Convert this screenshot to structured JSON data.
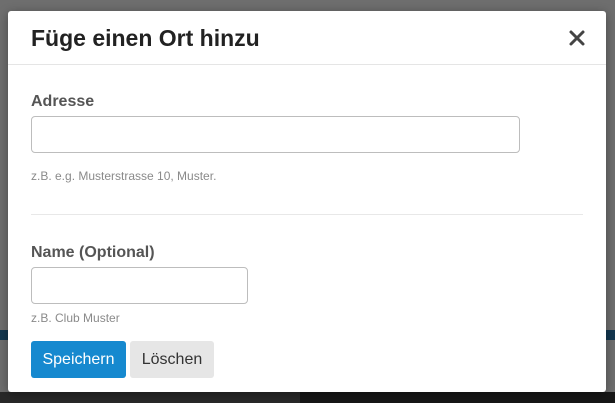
{
  "modal": {
    "title": "Füge einen Ort hinzu",
    "close_icon": "close-icon"
  },
  "address": {
    "label": "Adresse",
    "value": "",
    "placeholder": "",
    "hint": "z.B. e.g. Musterstrasse 10, Muster."
  },
  "name": {
    "label": "Name (Optional)",
    "value": "",
    "placeholder": "",
    "hint": "z.B. Club Muster"
  },
  "actions": {
    "save_label": "Speichern",
    "delete_label": "Löschen"
  },
  "colors": {
    "primary": "#1689cf",
    "secondary": "#e6e6e6",
    "overlay": "#6b6b6b"
  }
}
